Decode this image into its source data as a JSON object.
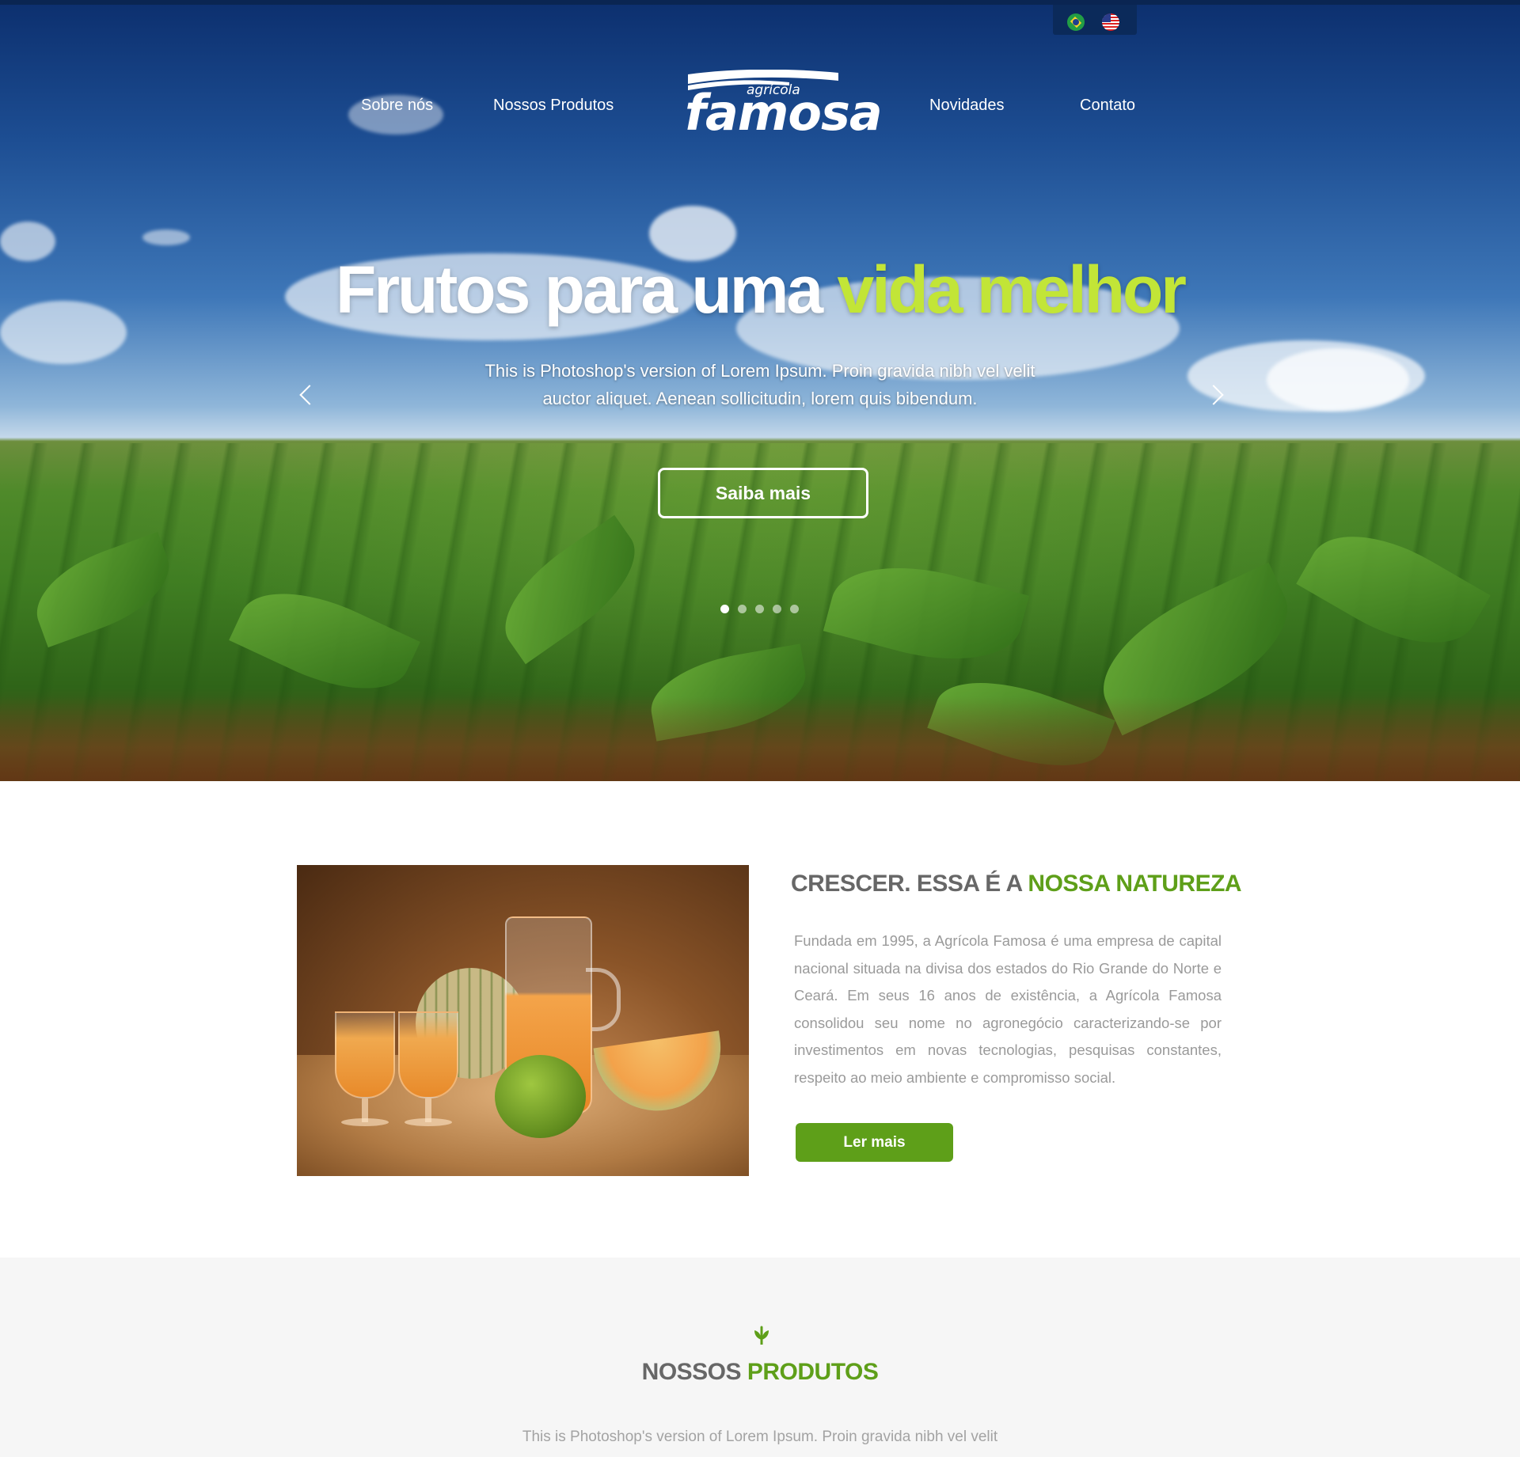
{
  "language_switch": {
    "brazil_flag": "flag-brazil-icon",
    "us_flag": "flag-usa-icon"
  },
  "nav": {
    "items": [
      "Sobre nós",
      "Nossos Produtos",
      "Novidades",
      "Contato"
    ]
  },
  "logo": {
    "small": "agrícola",
    "main": "famosa"
  },
  "hero": {
    "title_main": "Frutos para uma",
    "title_accent": "vida melhor",
    "subtitle_line1": "This is Photoshop's version  of Lorem Ipsum. Proin gravida nibh vel velit",
    "subtitle_line2": "auctor aliquet. Aenean sollicitudin, lorem quis bibendum.",
    "cta_label": "Saiba mais",
    "slide_count": 5,
    "active_slide": 1
  },
  "about": {
    "title_main": "CRESCER. ESSA É A",
    "title_accent": "NOSSA NATUREZA",
    "paragraph": "Fundada em 1995, a Agrícola Famosa é uma empresa de capital nacional situada na divisa dos estados do Rio Grande do Norte e Ceará. Em seus 16 anos de existência, a Agrícola Famosa consolidou seu nome no agronegócio caracterizando-se por investimentos em novas tecnologias, pesquisas constantes, respeito ao meio ambiente e compromisso social.",
    "button_label": "Ler mais"
  },
  "products": {
    "icon": "sprout-icon",
    "title_main": "NOSSOS",
    "title_accent": "PRODUTOS",
    "text": "This is Photoshop's version  of Lorem Ipsum. Proin gravida nibh vel velit"
  },
  "colors": {
    "accent_green": "#5e9f19",
    "hero_accent": "#c2e537",
    "heading_gray": "#676767",
    "text_gray": "#9a9a9a"
  }
}
